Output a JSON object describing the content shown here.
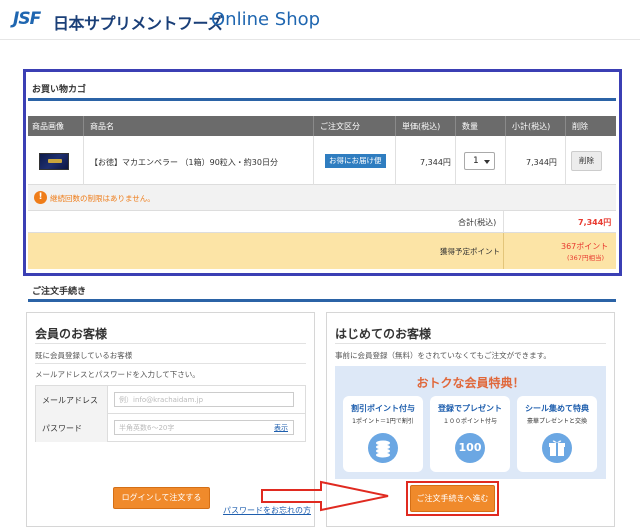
{
  "header": {
    "logo_mark": "JSF",
    "logo_name": "日本サプリメントフーズ",
    "logo_online": "Online Shop"
  },
  "cart": {
    "title": "お買い物カゴ",
    "columns": [
      "商品画像",
      "商品名",
      "ご注文区分",
      "単価(税込)",
      "数量",
      "小計(税込)",
      "削除"
    ],
    "item": {
      "name": "【お徳】マカエンペラー （1箱）90粒入・約30日分",
      "order_type": "お得にお届け便",
      "unit_price": "7,344円",
      "quantity": "1",
      "subtotal": "7,344円",
      "delete_label": "削除"
    },
    "notice": "継続回数の制限はありません。",
    "total_label": "合計(税込)",
    "total_value": "7,344円",
    "points_label": "獲得予定ポイント",
    "points_value": "367ポイント",
    "points_sub": "(367円相当)"
  },
  "checkout": {
    "title": "ご注文手続き"
  },
  "member": {
    "title": "会員のお客様",
    "text1": "既に会員登録しているお客様",
    "text2": "メールアドレスとパスワードを入力して下さい。",
    "email_label": "メールアドレス",
    "email_placeholder": "例）info@krachaidam.jp",
    "password_label": "パスワード",
    "password_placeholder": "半角英数6～20字",
    "show_label": "表示",
    "login_button": "ログインして注文する",
    "forgot_link": "パスワードをお忘れの方"
  },
  "guest": {
    "title": "はじめてのお客様",
    "text": "事前に会員登録（無料）をされていなくてもご注文ができます。",
    "benefit_title": "おトクな会員特典！",
    "cards": [
      {
        "title": "割引ポイント付与",
        "sub": "1ポイント＝1円で割引",
        "icon_text": "",
        "icon": "coin-stack-icon"
      },
      {
        "title": "登録でプレゼント",
        "sub": "１００ポイント付与",
        "icon_text": "100",
        "icon": "points-100-icon"
      },
      {
        "title": "シール集めて特典",
        "sub": "豪華プレゼントと交換",
        "icon_text": "",
        "icon": "gift-icon"
      }
    ],
    "proceed_button": "ご注文手続きへ進む"
  },
  "colors": {
    "brand_blue": "#2b63a6",
    "orange": "#f08a2b",
    "highlight_red": "#e02a20",
    "frame_purple": "#3b3fb4"
  }
}
